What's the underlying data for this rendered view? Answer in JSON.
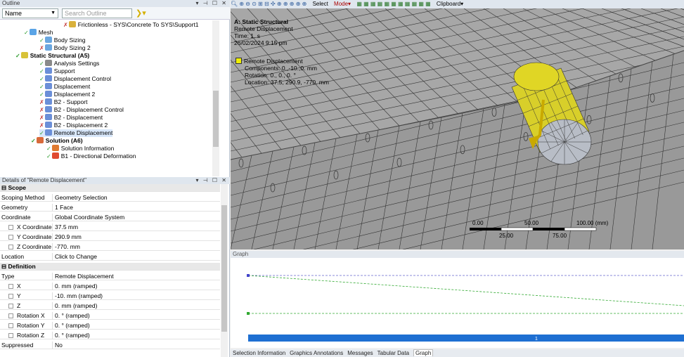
{
  "outline": {
    "title": "Outline",
    "window_controls": "▾ ⊣ ☐ ✕",
    "name_filter": "Name",
    "search_placeholder": "Search Outline",
    "tree": [
      {
        "label": "Frictionless - SYS\\Concrete To SYS\\Support1",
        "indent": 90,
        "state": "x",
        "color": "#d9b13b",
        "bold": false
      },
      {
        "label": "Mesh",
        "indent": 34,
        "state": "chk",
        "color": "#5aa4e6",
        "bold": false
      },
      {
        "label": "Body Sizing",
        "indent": 56,
        "state": "chk",
        "color": "#6aa7e0",
        "bold": false
      },
      {
        "label": "Body Sizing 2",
        "indent": 56,
        "state": "x",
        "color": "#6aa7e0",
        "bold": false
      },
      {
        "label": "Static Structural (A5)",
        "indent": 22,
        "state": "chk",
        "color": "#d8c238",
        "bold": true
      },
      {
        "label": "Analysis Settings",
        "indent": 56,
        "state": "chk",
        "color": "#8a8a8a",
        "bold": false
      },
      {
        "label": "Support",
        "indent": 56,
        "state": "chk",
        "color": "#6b8fd8",
        "bold": false
      },
      {
        "label": "Displacement Control",
        "indent": 56,
        "state": "chk",
        "color": "#6b8fd8",
        "bold": false
      },
      {
        "label": "Displacement",
        "indent": 56,
        "state": "chk",
        "color": "#6b8fd8",
        "bold": false
      },
      {
        "label": "Displacement 2",
        "indent": 56,
        "state": "chk",
        "color": "#6b8fd8",
        "bold": false
      },
      {
        "label": "B2 - Support",
        "indent": 56,
        "state": "x",
        "color": "#6b8fd8",
        "bold": false
      },
      {
        "label": "B2 - Displacement Control",
        "indent": 56,
        "state": "x",
        "color": "#6b8fd8",
        "bold": false
      },
      {
        "label": "B2 - Displacement",
        "indent": 56,
        "state": "x",
        "color": "#6b8fd8",
        "bold": false
      },
      {
        "label": "B2 - Displacement 2",
        "indent": 56,
        "state": "x",
        "color": "#6b8fd8",
        "bold": false
      },
      {
        "label": "Remote Displacement",
        "indent": 56,
        "state": "chk",
        "color": "#6b8fd8",
        "bold": false,
        "selected": true
      },
      {
        "label": "Solution (A6)",
        "indent": 44,
        "state": "chk",
        "color": "#d86a3a",
        "bold": true
      },
      {
        "label": "Solution Information",
        "indent": 66,
        "state": "chk",
        "color": "#e07a30",
        "bold": false
      },
      {
        "label": "B1 - Directional Deformation",
        "indent": 66,
        "state": "chk",
        "color": "#e04a30",
        "bold": false
      }
    ]
  },
  "details": {
    "title": "Details of \"Remote Displacement\"",
    "window_controls": "▾ ⊣ ☐ ✕",
    "rows": [
      {
        "group": true,
        "key": "Scope"
      },
      {
        "key": "Scoping Method",
        "value": "Geometry Selection"
      },
      {
        "key": "Geometry",
        "value": "1 Face"
      },
      {
        "key": "Coordinate System",
        "value": "Global Coordinate System"
      },
      {
        "key": "X Coordinate",
        "value": "37.5 mm",
        "checkbox": true
      },
      {
        "key": "Y Coordinate",
        "value": "290.9 mm",
        "checkbox": true
      },
      {
        "key": "Z Coordinate",
        "value": "-770. mm",
        "checkbox": true
      },
      {
        "key": "Location",
        "value": "Click to Change"
      },
      {
        "group": true,
        "key": "Definition"
      },
      {
        "key": "Type",
        "value": "Remote Displacement"
      },
      {
        "key": "X Component",
        "value": "0. mm  (ramped)",
        "checkbox": true
      },
      {
        "key": "Y Component",
        "value": "-10. mm  (ramped)",
        "checkbox": true
      },
      {
        "key": "Z Component",
        "value": "0. mm  (ramped)",
        "checkbox": true
      },
      {
        "key": "Rotation X",
        "value": "0. °  (ramped)",
        "checkbox": true
      },
      {
        "key": "Rotation Y",
        "value": "0. °  (ramped)",
        "checkbox": true
      },
      {
        "key": "Rotation Z",
        "value": "0. °  (ramped)",
        "checkbox": true
      },
      {
        "key": "Suppressed",
        "value": "No"
      }
    ]
  },
  "toolbar": [
    "Select",
    "Mode▾",
    "Clipboard▾"
  ],
  "viewport": {
    "analysis_title": "A: Static Structural",
    "object_name": "Remote Displacement",
    "time": "Time: 1. s",
    "date": "26/02/2024 9:15 pm",
    "legend_label": "Remote Displacement",
    "components": "Components: 0.,-10.,0. mm",
    "rotation": "Rotation: 0., 0., 0. °",
    "location": "Location: 37.5, 290.9, -770. mm",
    "scale_labels": [
      "0.00",
      "50.00",
      "100.00 (mm)",
      "25.00",
      "75.00"
    ],
    "colors": {
      "highlight": "#e2d300",
      "mesh_fill": "#9a9a9a",
      "mesh_line": "#333333"
    }
  },
  "graph": {
    "title": "Graph",
    "timeline_label": "1"
  },
  "bottom_tabs": [
    {
      "label": "Selection Information",
      "active": false
    },
    {
      "label": "Graphics Annotations",
      "active": false
    },
    {
      "label": "Messages",
      "active": false
    },
    {
      "label": "Tabular Data",
      "active": false
    },
    {
      "label": "Graph",
      "active": true
    }
  ]
}
